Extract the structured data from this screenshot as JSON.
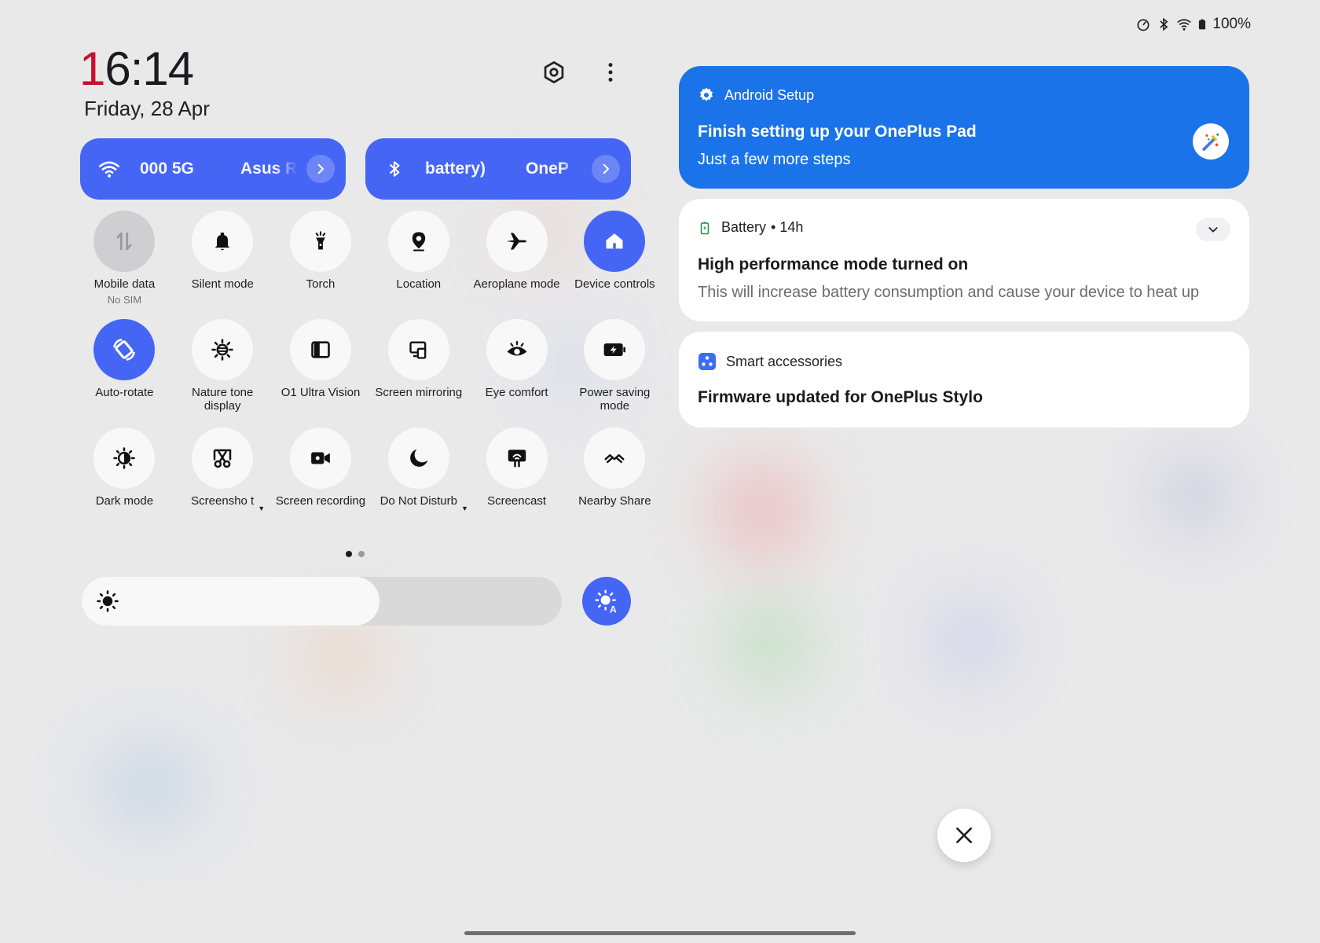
{
  "status_bar": {
    "battery_percent": "100%"
  },
  "clock": {
    "time_first": "1",
    "time_rest": "6:14",
    "date": "Friday, 28 Apr"
  },
  "pills": [
    {
      "text1": "000 5G",
      "text2": "Asus R"
    },
    {
      "text1": "battery)",
      "text2": "OneP"
    }
  ],
  "tiles": [
    {
      "label": "Mobile data",
      "sub": "No SIM",
      "icon": "mobile-data-icon",
      "state": "disabled"
    },
    {
      "label": "Silent mode",
      "icon": "bell-icon",
      "state": "off"
    },
    {
      "label": "Torch",
      "icon": "torch-icon",
      "state": "off"
    },
    {
      "label": "Location",
      "icon": "location-icon",
      "state": "off"
    },
    {
      "label": "Aeroplane mode",
      "icon": "aeroplane-icon",
      "state": "off"
    },
    {
      "label": "Device controls",
      "icon": "home-icon",
      "state": "active"
    },
    {
      "label": "Auto-rotate",
      "icon": "auto-rotate-icon",
      "state": "active"
    },
    {
      "label": "Nature tone display",
      "icon": "sun-filter-icon",
      "state": "off"
    },
    {
      "label": "O1 Ultra Vision",
      "icon": "ultra-vision-icon",
      "state": "off"
    },
    {
      "label": "Screen mirroring",
      "icon": "screen-mirroring-icon",
      "state": "off"
    },
    {
      "label": "Eye comfort",
      "icon": "eye-icon",
      "state": "off"
    },
    {
      "label": "Power saving mode",
      "icon": "battery-saver-icon",
      "state": "off"
    },
    {
      "label": "Dark mode",
      "icon": "dark-mode-icon",
      "state": "off"
    },
    {
      "label": "Screensho t",
      "icon": "scissors-icon",
      "state": "off",
      "caret": true
    },
    {
      "label": "Screen recording",
      "icon": "video-camera-icon",
      "state": "off"
    },
    {
      "label": "Do Not Disturb",
      "icon": "moon-icon",
      "state": "off",
      "caret": true
    },
    {
      "label": "Screencast",
      "icon": "screencast-icon",
      "state": "off"
    },
    {
      "label": "Nearby Share",
      "icon": "nearby-share-icon",
      "state": "off"
    }
  ],
  "brightness": {
    "level": 0.62
  },
  "notifications": [
    {
      "app": "Android Setup",
      "title": "Finish setting up your OnePlus Pad",
      "body": "Just a few more steps"
    },
    {
      "app": "Battery",
      "time": "• 14h",
      "title": "High performance mode turned on",
      "body": "This will increase battery consumption and cause your device to heat up"
    },
    {
      "app": "Smart accessories",
      "title": "Firmware updated for OnePlus Stylo"
    }
  ],
  "colors": {
    "accent": "#4565f5",
    "setup_blue": "#1a73e8",
    "clock_red": "#c8102e"
  }
}
